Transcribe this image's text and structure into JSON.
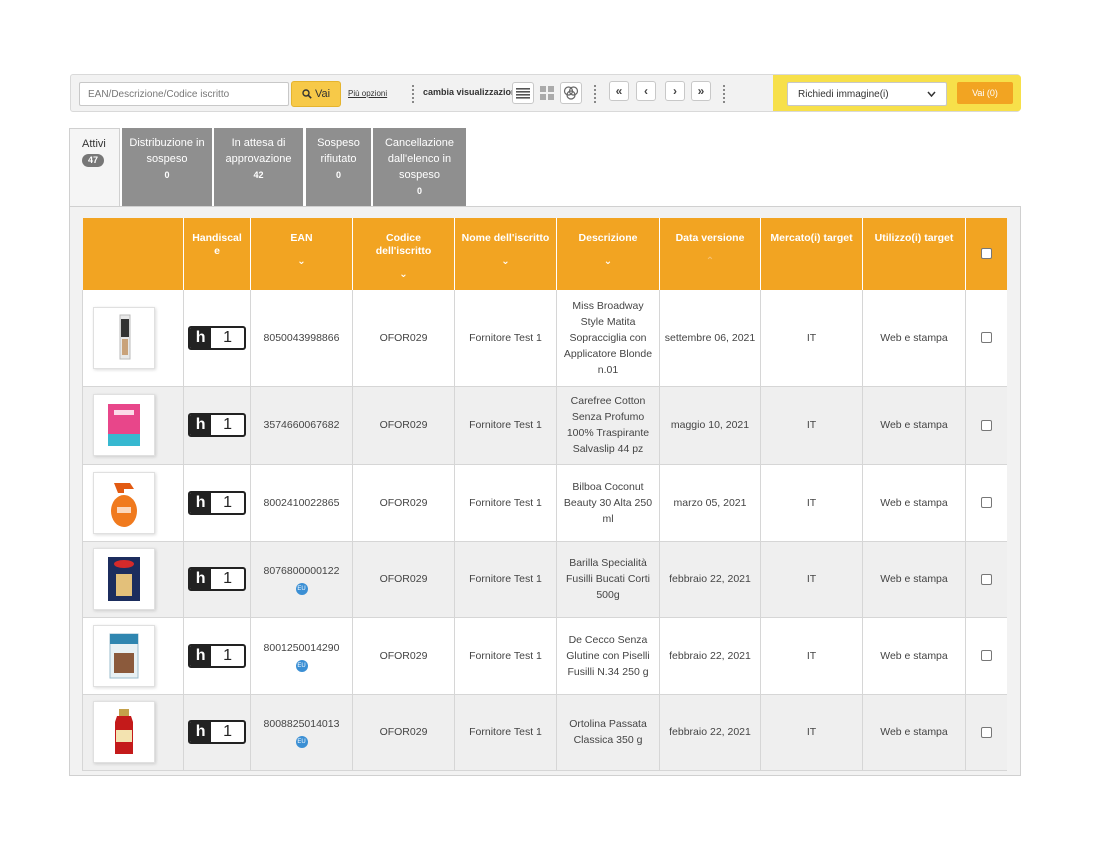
{
  "toolbar": {
    "search_placeholder": "EAN/Descrizione/Codice iscritto",
    "search_button": "Vai",
    "more_options": "Più opzioni",
    "view_label": "cambia visualizzazione",
    "action_select_value": "Richiedi immagine(i)",
    "action_button": "Vai (0)"
  },
  "tabs": [
    {
      "label": "Attivi",
      "count": "47"
    },
    {
      "label": "Distribuzione in sospeso",
      "count": "0"
    },
    {
      "label": "In attesa di approvazione",
      "count": "42"
    },
    {
      "label": "Sospeso rifiutato",
      "count": "0"
    },
    {
      "label": "Cancellazione dall'elenco in sospeso",
      "count": "0"
    }
  ],
  "table": {
    "headers": {
      "handiscale": "Handiscal e",
      "ean": "EAN",
      "codice": "Codice dell'iscritto",
      "nome": "Nome dell'iscritto",
      "descrizione": "Descrizione",
      "data": "Data versione",
      "mercato": "Mercato(i) target",
      "utilizzo": "Utilizzo(i) target"
    },
    "rows": [
      {
        "handiscale": "1",
        "ean": "8050043998866",
        "eu": "",
        "codice": "OFOR029",
        "nome": "Fornitore Test 1",
        "descrizione": "Miss Broadway Style Matita Sopracciglia con Applicatore Blonde n.01",
        "data": "settembre 06, 2021",
        "mercato": "IT",
        "utilizzo": "Web e stampa"
      },
      {
        "handiscale": "1",
        "ean": "3574660067682",
        "eu": "",
        "codice": "OFOR029",
        "nome": "Fornitore Test 1",
        "descrizione": "Carefree Cotton Senza Profumo 100% Traspirante Salvaslip 44 pz",
        "data": "maggio 10, 2021",
        "mercato": "IT",
        "utilizzo": "Web e stampa"
      },
      {
        "handiscale": "1",
        "ean": "8002410022865",
        "eu": "",
        "codice": "OFOR029",
        "nome": "Fornitore Test 1",
        "descrizione": "Bilboa Coconut Beauty 30 Alta 250 ml",
        "data": "marzo 05, 2021",
        "mercato": "IT",
        "utilizzo": "Web e stampa"
      },
      {
        "handiscale": "1",
        "ean": "8076800000122",
        "eu": "EU",
        "codice": "OFOR029",
        "nome": "Fornitore Test 1",
        "descrizione": "Barilla Specialità Fusilli Bucati Corti 500g",
        "data": "febbraio 22, 2021",
        "mercato": "IT",
        "utilizzo": "Web e stampa"
      },
      {
        "handiscale": "1",
        "ean": "8001250014290",
        "eu": "EU",
        "codice": "OFOR029",
        "nome": "Fornitore Test 1",
        "descrizione": "De Cecco Senza Glutine con Piselli Fusilli N.34 250 g",
        "data": "febbraio 22, 2021",
        "mercato": "IT",
        "utilizzo": "Web e stampa"
      },
      {
        "handiscale": "1",
        "ean": "8008825014013",
        "eu": "EU",
        "codice": "OFOR029",
        "nome": "Fornitore Test 1",
        "descrizione": "Ortolina Passata Classica 350 g",
        "data": "febbraio 22, 2021",
        "mercato": "IT",
        "utilizzo": "Web e stampa"
      }
    ]
  },
  "colors": {
    "header_orange": "#f2a422",
    "go_yellow": "#f7c948",
    "action_yellow": "#f7e04a",
    "tab_gray": "#8f8f8f",
    "eu_blue": "#3b8fd4"
  },
  "icons": {
    "search": "search-icon",
    "list_view": "list-view-icon",
    "grid_view": "grid-view-icon",
    "compare_view": "compare-view-icon",
    "first": "first-page-icon",
    "prev": "prev-page-icon",
    "next": "next-page-icon",
    "last": "last-page-icon"
  }
}
